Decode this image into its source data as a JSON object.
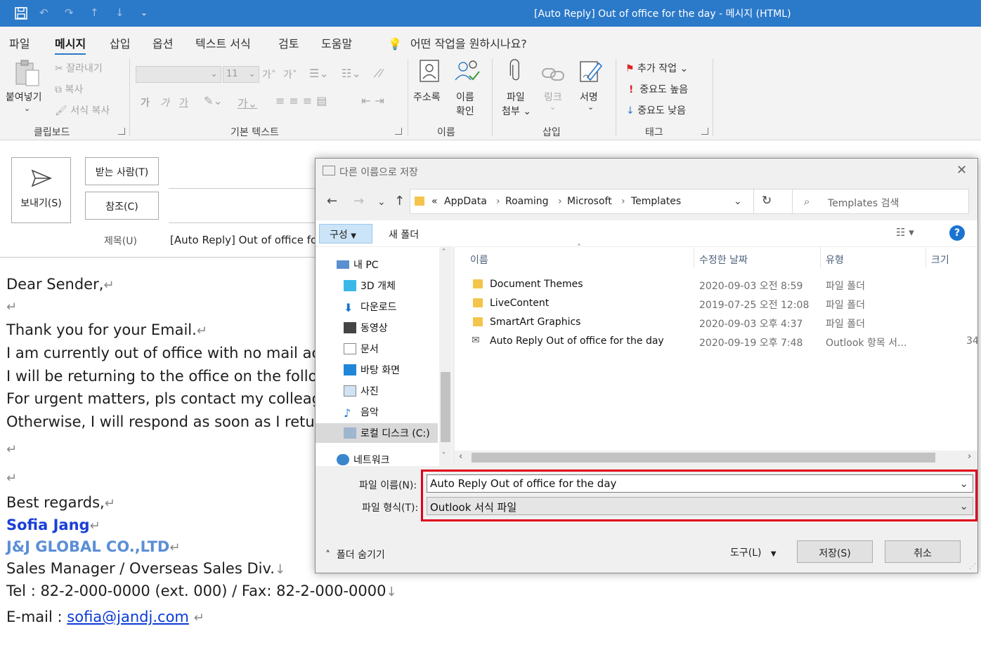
{
  "window": {
    "title": "[Auto Reply] Out of office for the day  -  메시지 (HTML)"
  },
  "ribbon_tabs": {
    "tabs": [
      "파일",
      "메시지",
      "삽입",
      "옵션",
      "텍스트 서식",
      "검토",
      "도움말"
    ],
    "active": "메시지",
    "tell_me": "어떤 작업을 원하시나요?"
  },
  "ribbon": {
    "clipboard": {
      "paste": "붙여넣기",
      "cut": "잘라내기",
      "copy": "복사",
      "format_painter": "서식 복사",
      "group": "클립보드"
    },
    "basic_text": {
      "font_size": "11",
      "group": "기본 텍스트"
    },
    "names": {
      "address_book": "주소록",
      "check_names_1": "이름",
      "check_names_2": "확인",
      "group": "이름"
    },
    "include": {
      "attach_1": "파일",
      "attach_2": "첨부",
      "link": "링크",
      "signature": "서명",
      "group": "삽입"
    },
    "tags": {
      "follow_up": "추가 작업",
      "high": "중요도 높음",
      "low": "중요도 낮음",
      "group": "태그"
    }
  },
  "compose": {
    "send": "보내기(S)",
    "to": "받는 사람(T)",
    "cc": "참조(C)",
    "subject_label": "제목(U)",
    "subject_value": "[Auto Reply] Out of office for"
  },
  "body": {
    "greeting": "Dear Sender,",
    "line1": "Thank you for your Email.",
    "line2": "I am currently out of office with no mail ac",
    "line3": "I will be returning to the office on the follo",
    "line4": "For urgent matters, pls contact my colleagu",
    "line5": "Otherwise, I will respond as soon as I retur",
    "regards": "Best regards,",
    "sig_name": "Sofia Jang",
    "sig_company": "J&J GLOBAL CO.,LTD",
    "sig_title": "Sales Manager / Overseas Sales Div.",
    "sig_tel": "Tel : 82-2-000-0000 (ext. 000) / Fax: 82-2-000-0000",
    "sig_email_label": "E-mail : ",
    "sig_email": "sofia@jandj.com",
    "return_mark": "↵",
    "soft_return_mark": "↓",
    "colors": {
      "name": "#1b3fd8",
      "company": "#5b8ed6"
    }
  },
  "dialog": {
    "title": "다른 이름으로 저장",
    "breadcrumb": [
      "«",
      "AppData",
      "Roaming",
      "Microsoft",
      "Templates"
    ],
    "search_placeholder": "Templates 검색",
    "organize": "구성",
    "new_folder": "새 폴더",
    "nav_items": [
      "내 PC",
      "3D 개체",
      "다운로드",
      "동영상",
      "문서",
      "바탕 화면",
      "사진",
      "음악",
      "로컬 디스크 (C:)",
      "네트워크"
    ],
    "columns": [
      "이름",
      "수정한 날짜",
      "유형",
      "크기"
    ],
    "files": [
      {
        "name": "Document Themes",
        "date": "2020-09-03 오전 8:59",
        "type": "파일 폴더",
        "size": ""
      },
      {
        "name": "LiveContent",
        "date": "2019-07-25 오전 12:08",
        "type": "파일 폴더",
        "size": ""
      },
      {
        "name": "SmartArt Graphics",
        "date": "2020-09-03 오후 4:37",
        "type": "파일 폴더",
        "size": ""
      },
      {
        "name": "Auto Reply Out of office for the day",
        "date": "2020-09-19 오후 7:48",
        "type": "Outlook 항목 서...",
        "size": "34"
      }
    ],
    "filename_label": "파일 이름(N):",
    "filename_value": "Auto Reply Out of office for the day",
    "filetype_label": "파일 형식(T):",
    "filetype_value": "Outlook 서식 파일",
    "hide_folders": "폴더 숨기기",
    "tools": "도구(L)",
    "save": "저장(S)",
    "cancel": "취소",
    "highlight_color": "#e0001a"
  }
}
